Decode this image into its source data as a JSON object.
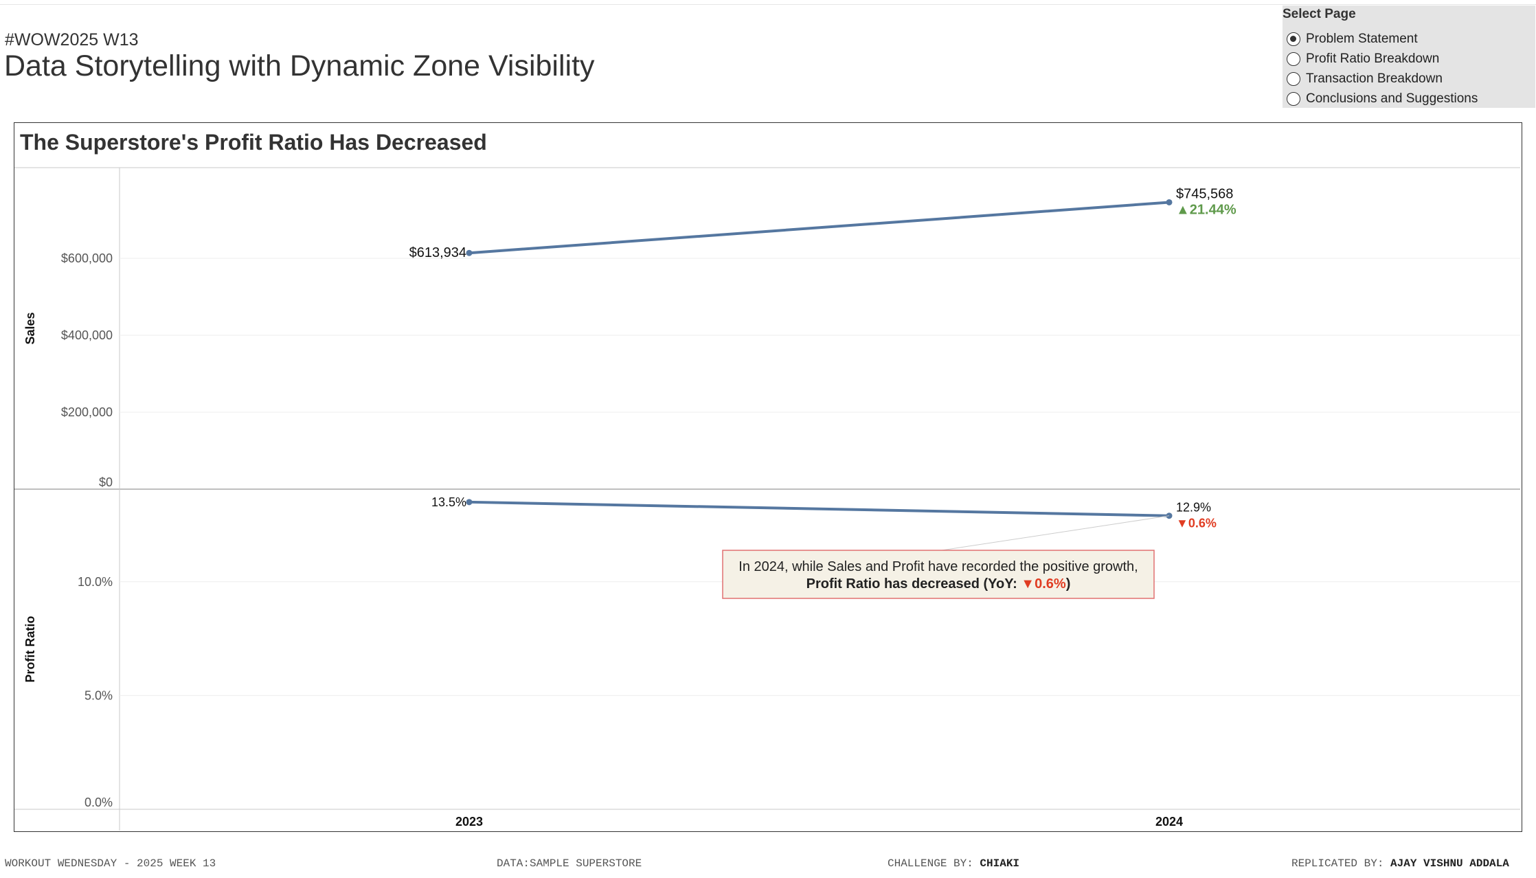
{
  "header": {
    "subtitle": "#WOW2025 W13",
    "title": "Data Storytelling with Dynamic Zone Visibility"
  },
  "page_selector": {
    "label": "Select Page",
    "options": [
      "Problem Statement",
      "Profit Ratio Breakdown",
      "Transaction Breakdown",
      "Conclusions and Suggestions"
    ],
    "selected": "Problem Statement"
  },
  "chart_data": {
    "type": "line",
    "title": "The Superstore's Profit Ratio Has Decreased",
    "x": [
      "2023",
      "2024"
    ],
    "panels": [
      {
        "ylabel": "Sales",
        "ylim": [
          0,
          800000
        ],
        "ticks": [
          0,
          200000,
          400000,
          600000
        ],
        "tick_labels": [
          "$0",
          "$200,000",
          "$400,000",
          "$600,000"
        ],
        "values": [
          613934,
          745568
        ],
        "value_labels": [
          "$613,934",
          "$745,568"
        ],
        "change_label": "▲21.44%",
        "change_direction": "up"
      },
      {
        "ylabel": "Profit Ratio",
        "ylim": [
          0,
          14.4
        ],
        "ticks": [
          0,
          5,
          10
        ],
        "tick_labels": [
          "0.0%",
          "5.0%",
          "10.0%"
        ],
        "values": [
          13.5,
          12.9
        ],
        "value_labels": [
          "13.5%",
          "12.9%"
        ],
        "change_label": "▼0.6%",
        "change_direction": "down"
      }
    ],
    "annotation": {
      "line1": "In 2024, while Sales and Profit have recorded the positive growth,",
      "line2_prefix": "Profit Ratio has decreased (YoY: ",
      "line2_value": "▼0.6%",
      "line2_suffix": ")"
    },
    "grid": true,
    "colors": {
      "line": "#5577a0",
      "up": "#5f9a4b",
      "down": "#e03c22",
      "grid": "#eeeeee",
      "axis": "#c8c8c8"
    }
  },
  "footer": {
    "workout": "WORKOUT WEDNESDAY - 2025 WEEK 13",
    "data": "DATA:SAMPLE SUPERSTORE",
    "challenge_label": "CHALLENGE BY: ",
    "challenge_name": "CHIAKI",
    "replicated_label": "REPLICATED BY: ",
    "replicated_name": "AJAY VISHNU ADDALA"
  }
}
